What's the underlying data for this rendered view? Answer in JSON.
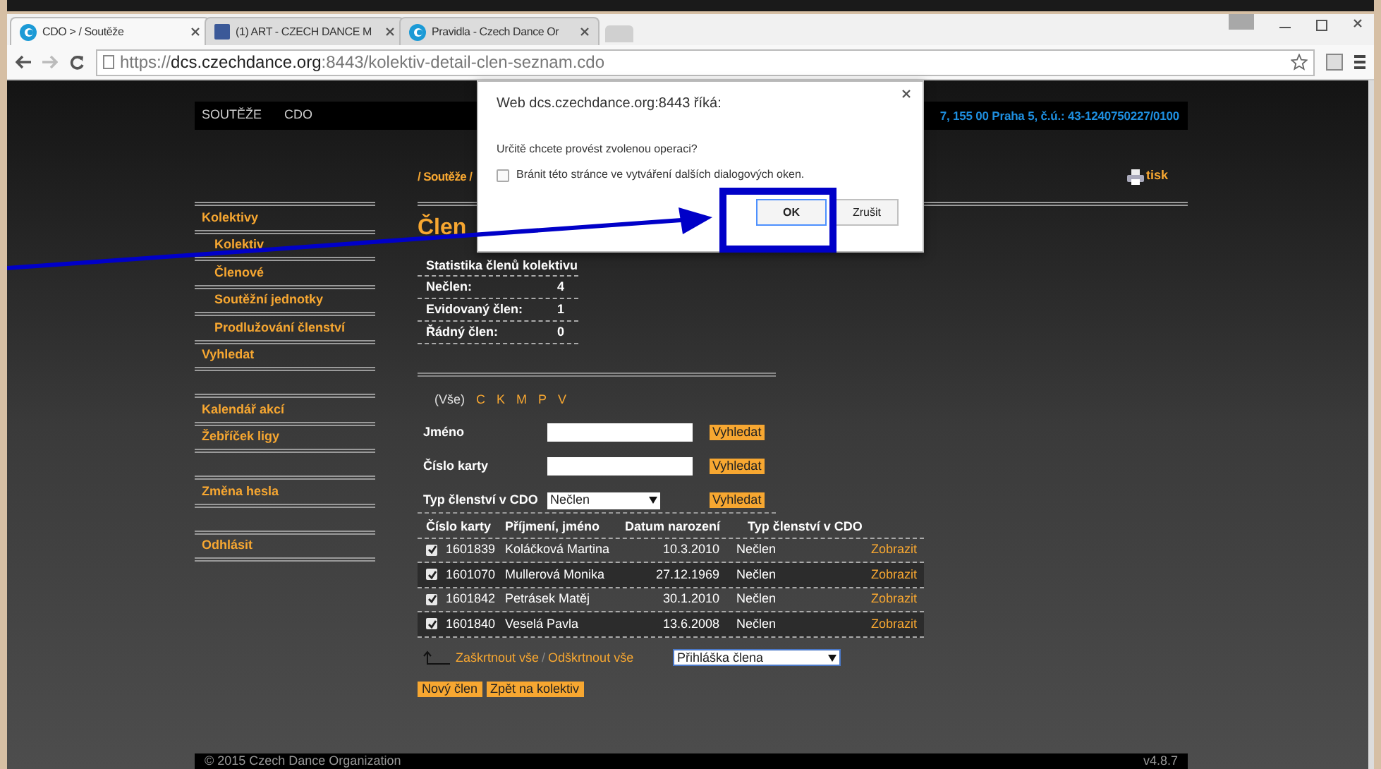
{
  "browser": {
    "tabs": [
      {
        "label": "CDO > / Soutěže",
        "selected": true
      },
      {
        "label": "(1) ART - CZECH DANCE M",
        "selected": false
      },
      {
        "label": "Pravidla - Czech Dance Or",
        "selected": false
      }
    ],
    "address": {
      "scheme": "https://",
      "host": "dcs.czechdance.org",
      "rest": ":8443/kolektiv-detail-clen-seznam.cdo"
    }
  },
  "header": {
    "menu": [
      "SOUTĚŽE",
      "CDO"
    ],
    "info": "7, 155 00 Praha 5, č.ú.: 43-1240750227/0100"
  },
  "breadcrumb": "/ Soutěže /",
  "print_link": "tisk",
  "sidebar": {
    "groups": [
      [
        {
          "label": "Kolektivy",
          "children": [
            {
              "label": "Kolektiv"
            },
            {
              "label": "Členové"
            },
            {
              "label": "Soutěžní jednotky"
            },
            {
              "label": "Prodlužování členství"
            }
          ]
        },
        {
          "label": "Vyhledat"
        }
      ],
      [
        {
          "label": "Kalendář akcí"
        },
        {
          "label": "Žebříček ligy"
        }
      ],
      [
        {
          "label": "Změna hesla"
        }
      ],
      [
        {
          "label": "Odhlásit"
        }
      ]
    ]
  },
  "page_title": "Člen",
  "stats": {
    "title": "Statistika členů kolektivu",
    "rows": [
      {
        "label": "Nečlen:",
        "value": "4"
      },
      {
        "label": "Evidovaný člen:",
        "value": "1"
      },
      {
        "label": "Řádný člen:",
        "value": "0"
      }
    ]
  },
  "letters": [
    {
      "label": "(Vše)",
      "selected": true
    },
    {
      "label": "C",
      "selected": false
    },
    {
      "label": "K",
      "selected": false
    },
    {
      "label": "M",
      "selected": false
    },
    {
      "label": "P",
      "selected": false
    },
    {
      "label": "V",
      "selected": false
    }
  ],
  "search": [
    {
      "label": "Jméno",
      "kind": "text",
      "button": "Vyhledat"
    },
    {
      "label": "Číslo karty",
      "kind": "text",
      "button": "Vyhledat"
    },
    {
      "label": "Typ členství v CDO",
      "kind": "select",
      "value": "Nečlen",
      "button": "Vyhledat"
    }
  ],
  "table": {
    "columns": [
      "Číslo karty",
      "Příjmení, jméno",
      "Datum narození",
      "Typ členství v CDO"
    ],
    "rows": [
      {
        "checked": true,
        "card": "1601839",
        "name": "Koláčková Martina",
        "born": "10.3.2010",
        "type": "Nečlen",
        "action": "Zobrazit"
      },
      {
        "checked": true,
        "card": "1601070",
        "name": "Mullerová Monika",
        "born": "27.12.1969",
        "type": "Nečlen",
        "action": "Zobrazit"
      },
      {
        "checked": true,
        "card": "1601842",
        "name": "Petrásek Matěj",
        "born": "30.1.2010",
        "type": "Nečlen",
        "action": "Zobrazit"
      },
      {
        "checked": true,
        "card": "1601840",
        "name": "Veselá Pavla",
        "born": "13.6.2008",
        "type": "Nečlen",
        "action": "Zobrazit"
      }
    ]
  },
  "bulk": {
    "check_all": "Zaškrtnout vše",
    "separator": "/",
    "uncheck_all": "Odškrtnout vše",
    "action": "Přihláška člena"
  },
  "buttons": [
    "Nový člen",
    "Zpět na kolektiv"
  ],
  "footer": {
    "copyright": "© 2015 Czech Dance Organization",
    "version": "v4.8.7"
  },
  "dialog": {
    "title": "Web dcs.czechdance.org:8443 říká:",
    "message": "Určitě chcete provést zvolenou operaci?",
    "checkbox": {
      "label": "Bránit této stránce ve vytváření dalších dialogových oken.",
      "checked": false
    },
    "ok": "OK",
    "cancel": "Zrušit"
  }
}
